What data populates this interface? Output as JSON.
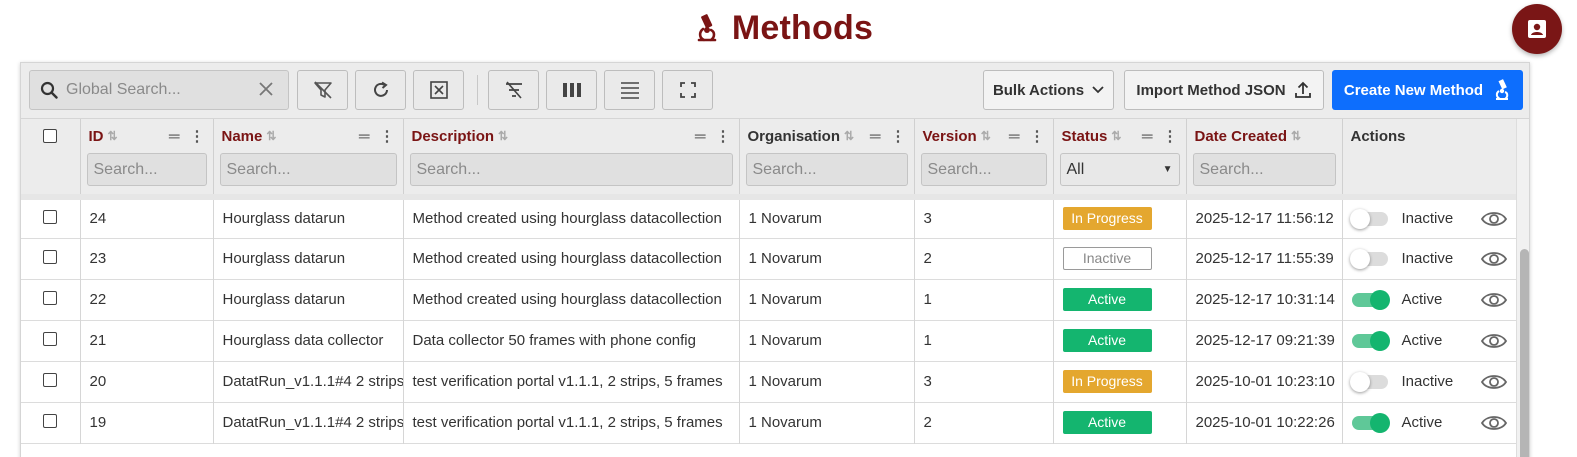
{
  "page": {
    "title": "Methods"
  },
  "toolbar": {
    "search_placeholder": "Global Search...",
    "bulk_actions_label": "Bulk Actions",
    "import_label": "Import Method JSON",
    "create_label": "Create New Method"
  },
  "columns": [
    {
      "label": "ID",
      "filter_placeholder": "Search..."
    },
    {
      "label": "Name",
      "filter_placeholder": "Search..."
    },
    {
      "label": "Description",
      "filter_placeholder": "Search..."
    },
    {
      "label": "Organisation",
      "filter_placeholder": "Search..."
    },
    {
      "label": "Version",
      "filter_placeholder": "Search..."
    },
    {
      "label": "Status",
      "filter_value": "All"
    },
    {
      "label": "Date Created",
      "filter_placeholder": "Search..."
    },
    {
      "label": "Actions"
    }
  ],
  "rows": [
    {
      "id": "24",
      "name": "Hourglass datarun",
      "description": "Method created using hourglass datacollection",
      "organisation": "1 Novarum",
      "version": "3",
      "status": "In Progress",
      "date": "2025-12-17 11:56:12",
      "toggle": "Inactive"
    },
    {
      "id": "23",
      "name": "Hourglass datarun",
      "description": "Method created using hourglass datacollection",
      "organisation": "1 Novarum",
      "version": "2",
      "status": "Inactive",
      "date": "2025-12-17 11:55:39",
      "toggle": "Inactive"
    },
    {
      "id": "22",
      "name": "Hourglass datarun",
      "description": "Method created using hourglass datacollection",
      "organisation": "1 Novarum",
      "version": "1",
      "status": "Active",
      "date": "2025-12-17 10:31:14",
      "toggle": "Active"
    },
    {
      "id": "21",
      "name": "Hourglass data collector",
      "description": "Data collector 50 frames with phone config",
      "organisation": "1 Novarum",
      "version": "1",
      "status": "Active",
      "date": "2025-12-17 09:21:39",
      "toggle": "Active"
    },
    {
      "id": "20",
      "name": "DatatRun_v1.1.1#4 2 strips",
      "description": "test verification portal v1.1.1, 2 strips, 5 frames",
      "organisation": "1 Novarum",
      "version": "3",
      "status": "In Progress",
      "date": "2025-10-01 10:23:10",
      "toggle": "Inactive"
    },
    {
      "id": "19",
      "name": "DatatRun_v1.1.1#4 2 strips",
      "description": "test verification portal v1.1.1, 2 strips, 5 frames",
      "organisation": "1 Novarum",
      "version": "2",
      "status": "Active",
      "date": "2025-10-01 10:22:26",
      "toggle": "Active"
    }
  ],
  "colors": {
    "brand": "#7a1414",
    "primary": "#0d6efd",
    "active": "#14b56f",
    "in_progress": "#e4a72f"
  }
}
